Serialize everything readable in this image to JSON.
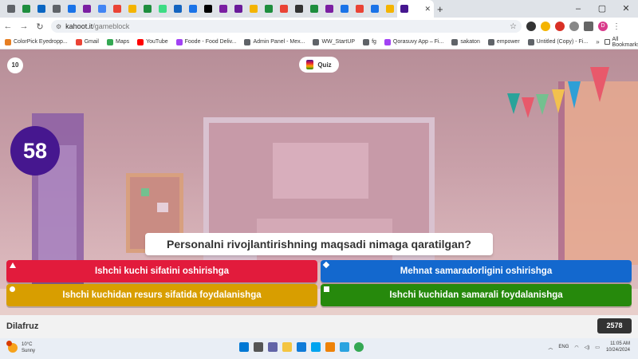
{
  "browser": {
    "tabs": [
      {
        "icon": "tab-favicon-icon",
        "color": "#5f6368"
      },
      {
        "icon": "tab-favicon-icon",
        "color": "#1e8e3e"
      },
      {
        "icon": "tab-favicon-icon",
        "color": "#0a66c2"
      },
      {
        "icon": "tab-favicon-icon",
        "color": "#5f6368"
      },
      {
        "icon": "tab-favicon-icon",
        "color": "#1a73e8"
      },
      {
        "icon": "tab-favicon-icon",
        "color": "#7b1fa2"
      },
      {
        "icon": "tab-favicon-icon",
        "color": "#4285f4"
      },
      {
        "icon": "tab-favicon-icon",
        "color": "#ea4335"
      },
      {
        "icon": "tab-favicon-icon",
        "color": "#f4b400"
      },
      {
        "icon": "tab-favicon-icon",
        "color": "#1e8e3e"
      },
      {
        "icon": "tab-favicon-icon",
        "color": "#3ddc84"
      },
      {
        "icon": "tab-favicon-icon",
        "color": "#1565c0"
      },
      {
        "icon": "tab-favicon-icon",
        "color": "#1a73e8"
      },
      {
        "icon": "tab-favicon-icon",
        "color": "#000000"
      },
      {
        "icon": "tab-favicon-icon",
        "color": "#7b1fa2"
      },
      {
        "icon": "tab-favicon-icon",
        "color": "#6a1b9a"
      },
      {
        "icon": "tab-favicon-icon",
        "color": "#f4b400"
      },
      {
        "icon": "tab-favicon-icon",
        "color": "#1e8e3e"
      },
      {
        "icon": "tab-favicon-icon",
        "color": "#ea4335"
      },
      {
        "icon": "tab-favicon-icon",
        "color": "#333333"
      },
      {
        "icon": "tab-favicon-icon",
        "color": "#1e8e3e"
      },
      {
        "icon": "tab-favicon-icon",
        "color": "#7b1fa2"
      },
      {
        "icon": "tab-favicon-icon",
        "color": "#1a73e8"
      },
      {
        "icon": "tab-favicon-icon",
        "color": "#ea4335"
      },
      {
        "icon": "tab-favicon-icon",
        "color": "#1a73e8"
      },
      {
        "icon": "tab-favicon-icon",
        "color": "#f4b400"
      },
      {
        "icon": "tab-favicon-icon",
        "color": "#46178f"
      }
    ],
    "new_tab": "+",
    "url_host": "kahoot.it",
    "url_path": "/gameblock",
    "profile_initial": "D"
  },
  "bookmarks": [
    {
      "label": "ColorPick Eyedropp...",
      "color": "#e67e22"
    },
    {
      "label": "Gmail",
      "color": "#ea4335"
    },
    {
      "label": "Maps",
      "color": "#34a853"
    },
    {
      "label": "YouTube",
      "color": "#ff0000"
    },
    {
      "label": "Foode - Food Deliv...",
      "color": "#a142f4"
    },
    {
      "label": "Admin Panel - Mex...",
      "color": "#5f6368"
    },
    {
      "label": "WW_StartUP",
      "color": "#5f6368"
    },
    {
      "label": "fg",
      "color": "#5f6368"
    },
    {
      "label": "Qorasuvy App – Fi...",
      "color": "#a142f4"
    },
    {
      "label": "sakaton",
      "color": "#5f6368"
    },
    {
      "label": "empower",
      "color": "#5f6368"
    },
    {
      "label": "Untitled (Copy) - Fi...",
      "color": "#5f6368"
    }
  ],
  "bookmarks_more": "»",
  "bookmarks_all": "All Bookmarks",
  "game": {
    "question_counter": "10",
    "quiz_label": "Quiz",
    "timer": "58",
    "question": "Personalni rivojlantirishning maqsadi nimaga qaratilgan?",
    "answers": [
      {
        "text": "Ishchi kuchi sifatini oshirishga",
        "color": "#e21b3c",
        "shape": "triangle"
      },
      {
        "text": "Mehnat samaradorligini oshirishga",
        "color": "#1368ce",
        "shape": "diamond"
      },
      {
        "text": "Ishchi kuchidan resurs sifatida foydalanishga",
        "color": "#d89e00",
        "shape": "circle"
      },
      {
        "text": "Ishchi kuchidan samarali foydalanishga",
        "color": "#26890c",
        "shape": "square"
      }
    ],
    "player_name": "Dilafruz",
    "score": "2578"
  },
  "taskbar": {
    "weather_temp": "10°C",
    "weather_desc": "Sunny",
    "language": "ENG",
    "time": "11:05 AM",
    "date": "10/24/2024"
  }
}
